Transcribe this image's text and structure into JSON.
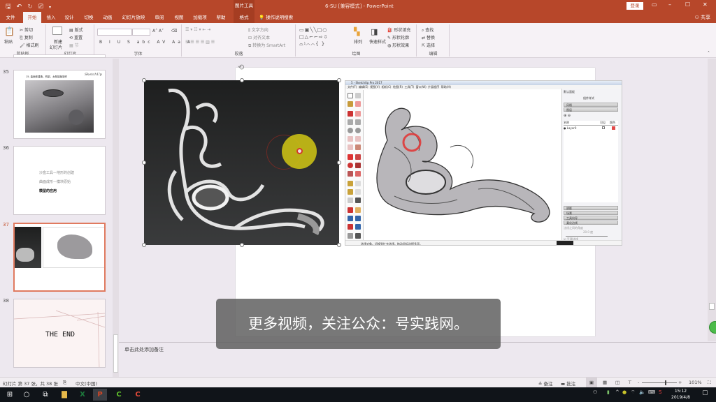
{
  "window": {
    "title": "6-SU [兼容模式] - PowerPoint",
    "context_tool_label": "图片工具",
    "login_label": "登录",
    "share_label": "共享",
    "controls": [
      "restore-ribbon",
      "minimize",
      "maximize",
      "close"
    ]
  },
  "quick_access": {
    "icons": [
      "save-icon",
      "undo-icon",
      "redo-icon",
      "presentation-icon",
      "customize-icon"
    ]
  },
  "tabs": [
    {
      "label": "文件",
      "active": false
    },
    {
      "label": "开始",
      "active": true
    },
    {
      "label": "插入",
      "active": false
    },
    {
      "label": "设计",
      "active": false
    },
    {
      "label": "切换",
      "active": false
    },
    {
      "label": "动画",
      "active": false
    },
    {
      "label": "幻灯片放映",
      "active": false
    },
    {
      "label": "审阅",
      "active": false
    },
    {
      "label": "视图",
      "active": false
    },
    {
      "label": "加载项",
      "active": false
    },
    {
      "label": "帮助",
      "active": false
    },
    {
      "label": "格式",
      "active": false
    },
    {
      "label": "操作说明搜索",
      "active": false
    }
  ],
  "ribbon": {
    "clipboard": {
      "label": "剪贴板",
      "paste": "粘贴",
      "cut": "剪切",
      "copy": "复制",
      "format_painter": "格式刷"
    },
    "slides": {
      "label": "幻灯片",
      "new_slide": "新建",
      "new_slide_2": "幻灯片",
      "layout": "版式",
      "reset": "重置",
      "section": "节"
    },
    "font": {
      "label": "字体",
      "font_name": "",
      "font_size": "",
      "buttons": [
        "B",
        "I",
        "U",
        "S",
        "abc",
        "AV",
        "Aa",
        "A"
      ]
    },
    "paragraph": {
      "label": "段落",
      "text_direction": "文字方向",
      "align_text": "对齐文本",
      "convert_smartart": "转换为 SmartArt"
    },
    "drawing": {
      "label": "绘图",
      "arrange": "排列",
      "quick_styles": "快速样式",
      "shape_fill": "形状填充",
      "shape_outline": "形状轮廓",
      "shape_effects": "形状效果"
    },
    "editing": {
      "label": "编辑",
      "find": "查找",
      "replace": "替换",
      "select": "选择"
    }
  },
  "thumbnails": [
    {
      "number": "35",
      "title": "15. 曲面体建造，构架，太阳能板制作",
      "logo": "SketchUp",
      "selected": false
    },
    {
      "number": "36",
      "lines": [
        "沙盒工具—地形的创建",
        "曲面成形—模块原始",
        "模型的应用"
      ],
      "selected": false
    },
    {
      "number": "37",
      "selected": true
    },
    {
      "number": "38",
      "text": "THE END",
      "selected": false
    }
  ],
  "sketchup": {
    "title": "5 - SketchUp Pro 2017",
    "menu": [
      "文件(F)",
      "编辑(E)",
      "视图(V)",
      "相机(C)",
      "绘图(R)",
      "工具(T)",
      "窗口(W)",
      "扩展程序",
      "帮助(H)"
    ],
    "tray_title": "默认面板",
    "tray_subtitle": "组件样式",
    "tray_sections_top": [
      "风格",
      "图层"
    ],
    "layer_headers": [
      "名称",
      "可见",
      "颜色"
    ],
    "layer_name": "Layer0",
    "layer_color": "#e04848",
    "tray_sections_bottom": [
      "阴影",
      "场景",
      "工具向导",
      "柔化边线"
    ],
    "smooth_label": "法线之间的角度",
    "smooth_value": "20.0 度",
    "checkbox_1": "平滑法线",
    "checkbox_2": "软化共面",
    "status_text": "选择对象。切换到扩充选择。拖动鼠标选择多项。"
  },
  "notes": {
    "placeholder": "单击此处添加备注"
  },
  "subtitle": "更多视频，关注公众：号实践网。",
  "statusbar": {
    "slide_info": "幻灯片 第 37 张，共 38 张",
    "language": "中文(中国)",
    "notes_label": "备注",
    "comments_label": "批注",
    "zoom_minus": "-",
    "zoom_plus": "+",
    "zoom_level": "101%",
    "zoom_percent": 101
  },
  "taskbar": {
    "apps": [
      "start",
      "search",
      "task-view",
      "file-explorer",
      "excel",
      "powerpoint",
      "camtasia",
      "camtasia-recorder"
    ],
    "time": "15:12",
    "date": "2019/4/8"
  },
  "colors": {
    "accent": "#b7472a",
    "selected_thumb_border": "#e07a5f"
  }
}
